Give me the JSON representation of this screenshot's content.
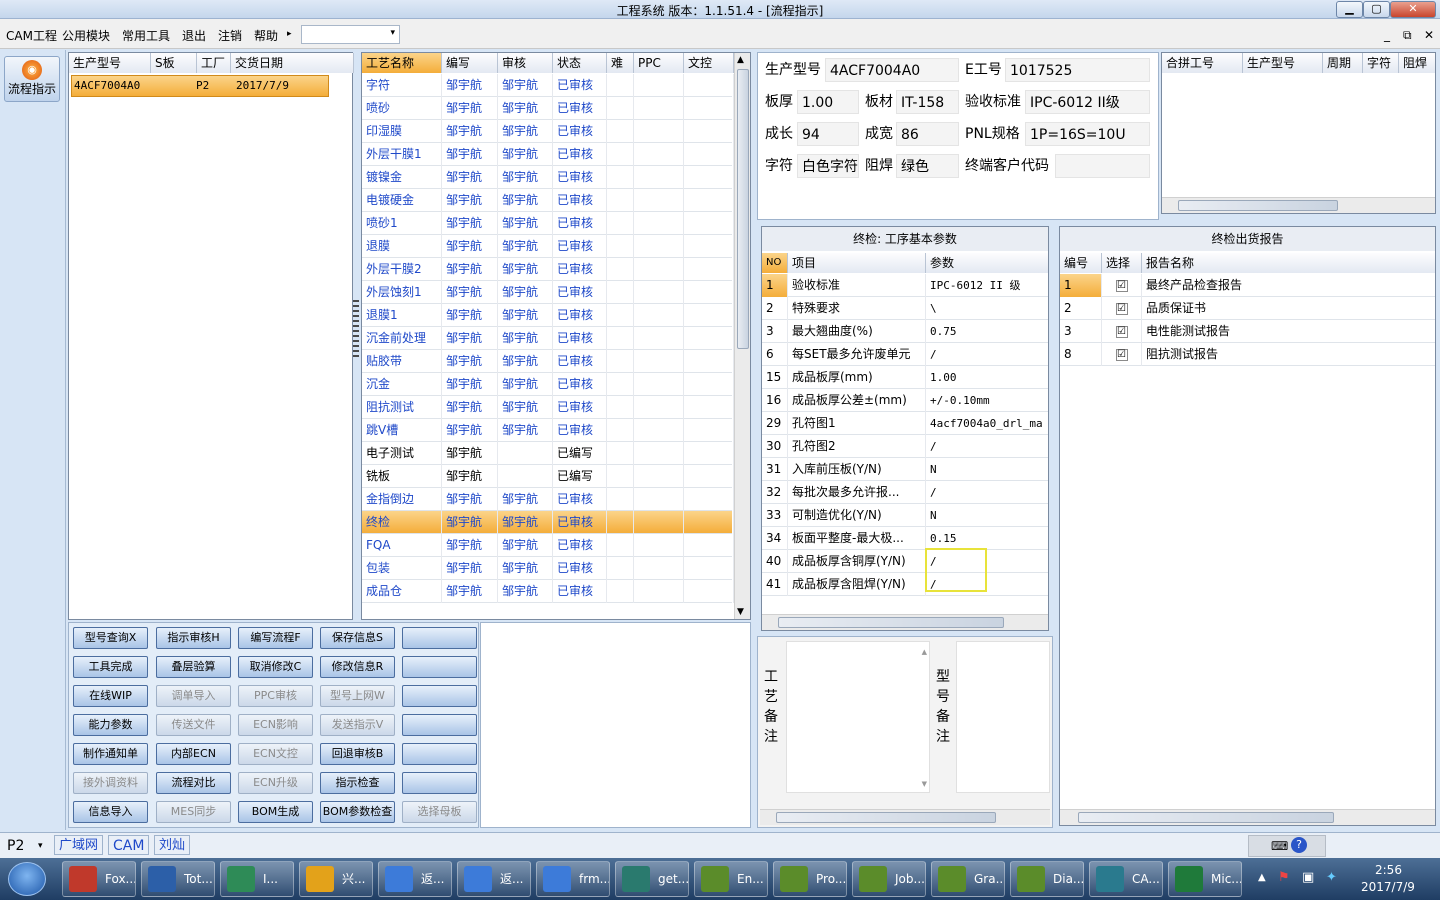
{
  "window": {
    "title": "工程系统   版本：1.1.51.4 - [流程指示]",
    "min_icon": "minimize-icon",
    "max_icon": "maximize-icon",
    "close_icon": "close-icon"
  },
  "menu": {
    "items": [
      "CAM工程",
      "公用模块",
      "常用工具",
      "退出",
      "注销",
      "帮助"
    ],
    "help_arrow": "▸",
    "combo_value": "",
    "mdi_controls": [
      "_",
      "⧉",
      "✕"
    ]
  },
  "side": {
    "flow_button": "流程指示"
  },
  "product_list": {
    "headers": [
      "生产型号",
      "S板",
      "工厂",
      "交货日期"
    ],
    "rows": [
      [
        "4ACF7004A0",
        "",
        "P2",
        "2017/7/9"
      ]
    ]
  },
  "process": {
    "headers": [
      "工艺名称",
      "编写",
      "审核",
      "状态",
      "难",
      "PPC",
      "文控"
    ],
    "rows": [
      [
        "字符",
        "邹宇航",
        "邹宇航",
        "已审核"
      ],
      [
        "喷砂",
        "邹宇航",
        "邹宇航",
        "已审核"
      ],
      [
        "印湿膜",
        "邹宇航",
        "邹宇航",
        "已审核"
      ],
      [
        "外层干膜1",
        "邹宇航",
        "邹宇航",
        "已审核"
      ],
      [
        "镀镍金",
        "邹宇航",
        "邹宇航",
        "已审核"
      ],
      [
        "电镀硬金",
        "邹宇航",
        "邹宇航",
        "已审核"
      ],
      [
        "喷砂1",
        "邹宇航",
        "邹宇航",
        "已审核"
      ],
      [
        "退膜",
        "邹宇航",
        "邹宇航",
        "已审核"
      ],
      [
        "外层干膜2",
        "邹宇航",
        "邹宇航",
        "已审核"
      ],
      [
        "外层蚀刻1",
        "邹宇航",
        "邹宇航",
        "已审核"
      ],
      [
        "退膜1",
        "邹宇航",
        "邹宇航",
        "已审核"
      ],
      [
        "沉金前处理",
        "邹宇航",
        "邹宇航",
        "已审核"
      ],
      [
        "贴胶带",
        "邹宇航",
        "邹宇航",
        "已审核"
      ],
      [
        "沉金",
        "邹宇航",
        "邹宇航",
        "已审核"
      ],
      [
        "阻抗测试",
        "邹宇航",
        "邹宇航",
        "已审核"
      ],
      [
        "跳V槽",
        "邹宇航",
        "邹宇航",
        "已审核"
      ],
      [
        "电子测试",
        "邹宇航",
        "",
        "已编写"
      ],
      [
        "铣板",
        "邹宇航",
        "",
        "已编写"
      ],
      [
        "金指倒边",
        "邹宇航",
        "邹宇航",
        "已审核"
      ],
      [
        "终检",
        "邹宇航",
        "邹宇航",
        "已审核"
      ],
      [
        "FQA",
        "邹宇航",
        "邹宇航",
        "已审核"
      ],
      [
        "包装",
        "邹宇航",
        "邹宇航",
        "已审核"
      ],
      [
        "成品仓",
        "邹宇航",
        "邹宇航",
        "已审核"
      ]
    ],
    "selected_index": 19,
    "black_rows": [
      16,
      17
    ]
  },
  "buttons": [
    [
      "型号查询X",
      "指示审核H",
      "编写流程F",
      "保存信息S",
      ""
    ],
    [
      "工具完成",
      "叠层验算",
      "取消修改C",
      "修改信息R",
      ""
    ],
    [
      "在线WIP",
      "调单导入",
      "PPC审核",
      "型号上网W",
      ""
    ],
    [
      "能力参数",
      "传送文件",
      "ECN影响",
      "发送指示V",
      ""
    ],
    [
      "制作通知单",
      "内部ECN",
      "ECN文控",
      "回退审核B",
      ""
    ],
    [
      "接外调资料",
      "流程对比",
      "ECN升级",
      "指示检查",
      ""
    ],
    [
      "信息导入",
      "MES同步",
      "BOM生成",
      "BOM参数检查",
      "选择母板"
    ]
  ],
  "disabled_buttons": [
    "调单导入",
    "PPC审核",
    "型号上网W",
    "传送文件",
    "ECN影响",
    "发送指示V",
    "ECN文控",
    "接外调资料",
    "ECN升级",
    "MES同步",
    "选择母板"
  ],
  "info": {
    "prod_label": "生产型号",
    "prod_value": "4ACF7004A0",
    "e_label": "E工号",
    "e_value": "1017525",
    "thick_label": "板厚",
    "thick_value": "1.00",
    "mat_label": "板材",
    "mat_value": "IT-158",
    "std_label": "验收标准",
    "std_value": "IPC-6012 II级",
    "len_label": "成长",
    "len_value": "94",
    "wid_label": "成宽",
    "wid_value": "86",
    "pnl_label": "PNL规格",
    "pnl_value": "1P=16S=10U",
    "char_label": "字符",
    "char_value": "白色字符",
    "mask_label": "阻焊",
    "mask_value": "绿色",
    "cust_label": "终端客户代码",
    "cust_value": ""
  },
  "merge": {
    "headers": [
      "合拼工号",
      "生产型号",
      "周期",
      "字符",
      "阻焊"
    ]
  },
  "params": {
    "title": "终检: 工序基本参数",
    "headers": [
      "NO",
      "项目",
      "参数"
    ],
    "rows": [
      [
        "1",
        "验收标准",
        "IPC-6012 II 级"
      ],
      [
        "2",
        "特殊要求",
        "\\"
      ],
      [
        "3",
        "最大翘曲度(%)",
        "0.75"
      ],
      [
        "6",
        "每SET最多允许废单元",
        "/"
      ],
      [
        "15",
        "成品板厚(mm)",
        "1.00"
      ],
      [
        "16",
        "成品板厚公差±(mm)",
        "+/-0.10mm"
      ],
      [
        "29",
        "孔符图1",
        "4acf7004a0_drl_ma"
      ],
      [
        "30",
        "孔符图2",
        "/"
      ],
      [
        "31",
        "入库前压板(Y/N)",
        "N"
      ],
      [
        "32",
        "每批次最多允许报...",
        "/"
      ],
      [
        "33",
        "可制造优化(Y/N)",
        "N"
      ],
      [
        "34",
        "板面平整度-最大极...",
        "0.15"
      ],
      [
        "40",
        "成品板厚含铜厚(Y/N)",
        "/"
      ],
      [
        "41",
        "成品板厚含阻焊(Y/N)",
        "/"
      ]
    ]
  },
  "report": {
    "title": "终检出货报告",
    "headers": [
      "编号",
      "选择",
      "报告名称"
    ],
    "rows": [
      [
        "1",
        "☑",
        "最终产品检查报告"
      ],
      [
        "2",
        "☑",
        "品质保证书"
      ],
      [
        "3",
        "☑",
        "电性能测试报告"
      ],
      [
        "8",
        "☑",
        "阻抗测试报告"
      ]
    ]
  },
  "notes": {
    "process_note": [
      "工",
      "艺",
      "备",
      "注"
    ],
    "model_note": [
      "型",
      "号",
      "备",
      "注"
    ]
  },
  "status": {
    "plant": "P2",
    "tabs": [
      "广域网",
      "CAM",
      "刘灿"
    ]
  },
  "taskbar": {
    "items": [
      "Fox...",
      "Tot...",
      "I...",
      "兴...",
      "返...",
      "返...",
      "frm...",
      "get...",
      "En...",
      "Pro...",
      "Job...",
      "Gra...",
      "Dia...",
      "CA...",
      "Mic..."
    ],
    "time": "2:56",
    "date": "2017/7/9"
  },
  "colors": {
    "accent": "#1f49c9",
    "selected": "#f4ad3a",
    "highlight": "#e8e33a"
  }
}
